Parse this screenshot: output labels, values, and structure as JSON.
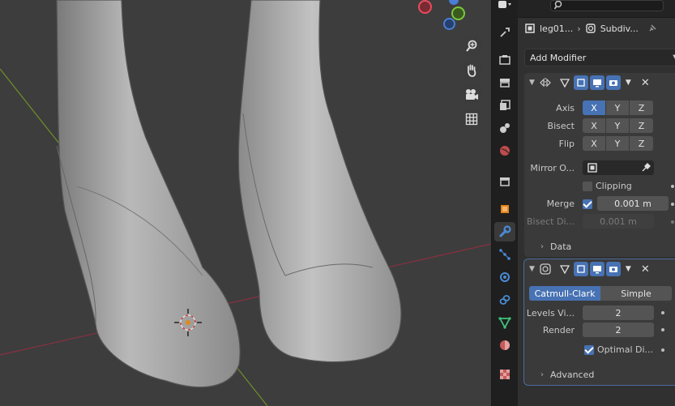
{
  "viewport": {
    "icons": [
      "zoom-icon",
      "hand-pan-icon",
      "camera-icon",
      "grid-icon"
    ],
    "axis_colors": {
      "x": "#e84b5c",
      "y": "#7bc83b",
      "z": "#4a7dd6"
    }
  },
  "header": {
    "object_name": "leg01...",
    "modifier_name": "Subdiv..."
  },
  "add_modifier_label": "Add Modifier",
  "mirror": {
    "axis_label": "Axis",
    "bisect_label": "Bisect",
    "flip_label": "Flip",
    "x": "X",
    "y": "Y",
    "z": "Z",
    "mirror_object_label": "Mirror O...",
    "clipping_label": "Clipping",
    "merge_label": "Merge",
    "merge_value": "0.001 m",
    "bisect_distance_label": "Bisect Di...",
    "bisect_distance_value": "0.001 m",
    "data_label": "Data"
  },
  "subdivision": {
    "catmull_label": "Catmull-Clark",
    "simple_label": "Simple",
    "levels_viewport_label": "Levels Vi...",
    "levels_viewport_value": "2",
    "render_label": "Render",
    "render_value": "2",
    "optimal_label": "Optimal Di...",
    "advanced_label": "Advanced"
  },
  "colors": {
    "accent": "#4772b3",
    "panel": "#3a3a3a"
  }
}
